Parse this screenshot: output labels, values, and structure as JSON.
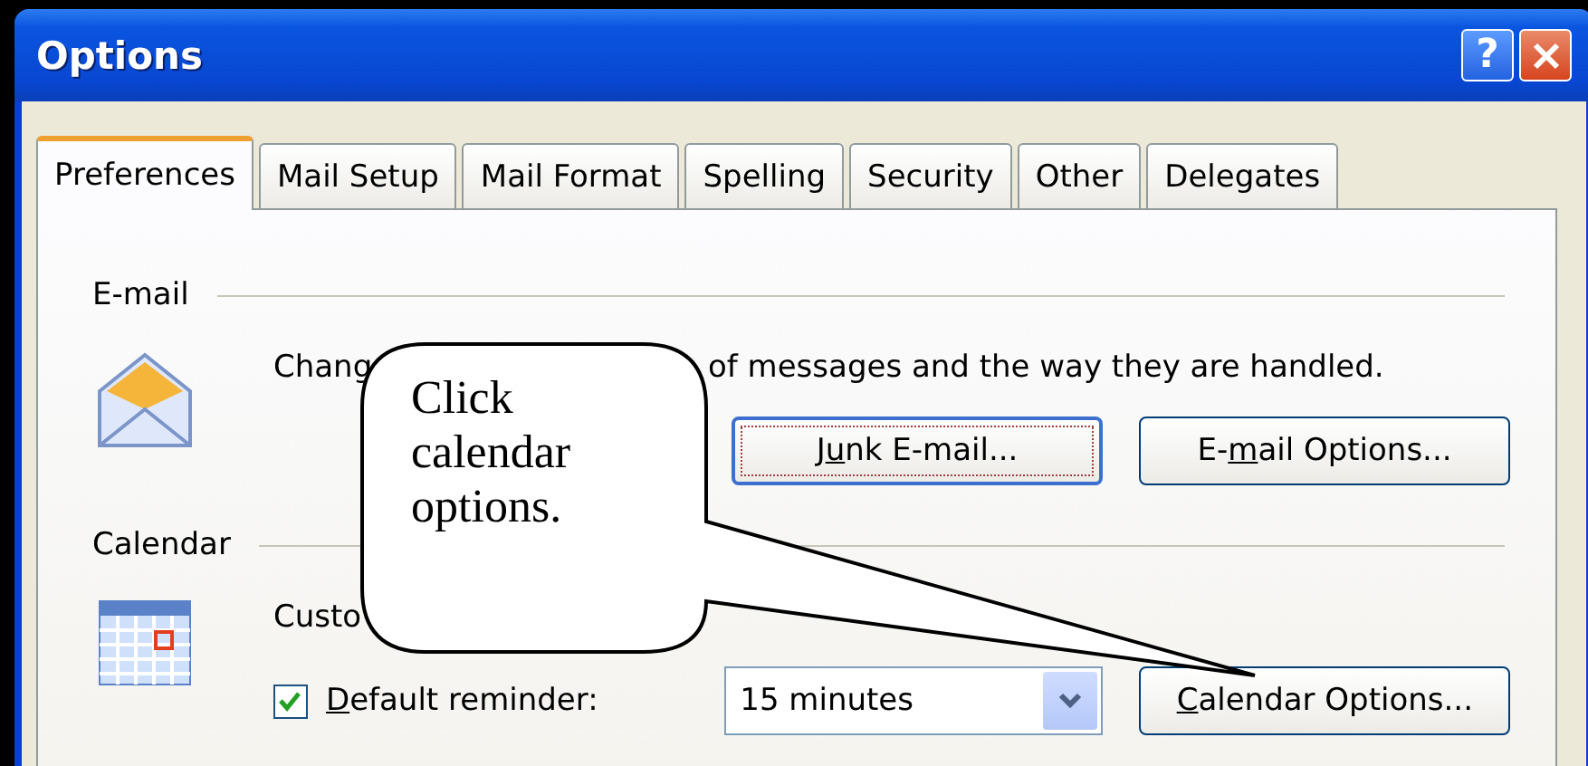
{
  "window": {
    "title": "Options",
    "buttons": [
      {
        "kind": "help",
        "label": "?"
      },
      {
        "kind": "close"
      }
    ]
  },
  "tabs": [
    {
      "label": "Preferences",
      "selected": true
    },
    {
      "label": "Mail Setup",
      "selected": false
    },
    {
      "label": "Mail Format",
      "selected": false
    },
    {
      "label": "Spelling",
      "selected": false
    },
    {
      "label": "Security",
      "selected": false
    },
    {
      "label": "Other",
      "selected": false
    },
    {
      "label": "Delegates",
      "selected": false
    }
  ],
  "sections": [
    {
      "kind": "email",
      "title": "E-mail",
      "text_start": "Chang",
      "text_end": "of messages and the way they are handled.",
      "buttons": [
        {
          "before": "J",
          "key": "u",
          "after": "nk E-mail...",
          "focused": true
        },
        {
          "before": "E-",
          "key": "m",
          "after": "ail Options...",
          "focused": false
        }
      ]
    },
    {
      "kind": "calendar",
      "title": "Calendar",
      "text_start": "Custo",
      "reminder": {
        "key": "D",
        "after": "efault reminder:",
        "checked": true
      },
      "select": {
        "value": "15 minutes"
      },
      "buttons": [
        {
          "key": "C",
          "after": "alendar Options...",
          "focused": false
        }
      ]
    }
  ],
  "callout": {
    "text": "Click calendar options."
  }
}
